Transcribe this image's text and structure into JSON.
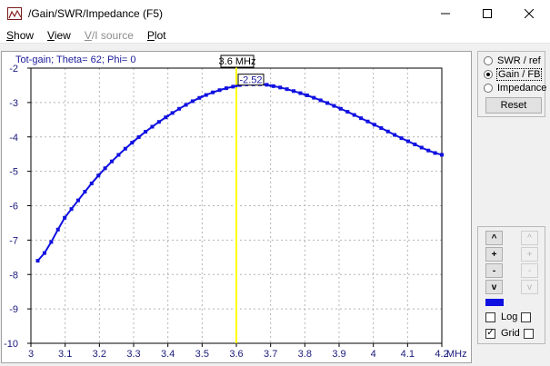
{
  "window": {
    "title": "/Gain/SWR/Impedance (F5)",
    "controls": {
      "minimize": "—",
      "maximize": "☐",
      "close": "✕"
    }
  },
  "menu": [
    {
      "label": "Show",
      "underline": "S",
      "rest": "how",
      "disabled": false
    },
    {
      "label": "View",
      "underline": "V",
      "rest": "iew",
      "disabled": false
    },
    {
      "label": "V/I source",
      "underline": "V",
      "rest": "/I source",
      "disabled": true
    },
    {
      "label": "Plot",
      "underline": "P",
      "rest": "lot",
      "disabled": false
    }
  ],
  "plot": {
    "header": "Tot-gain; Theta= 62; Phi= 0",
    "cursor": {
      "freq_label": "3.6 MHz",
      "value_label": "-2.52",
      "x": 3.6
    },
    "colors": {
      "curve": "#1010e0",
      "cursor": "#ffff00",
      "grid": "#b4b4b4"
    }
  },
  "chart_data": {
    "type": "line",
    "title": "Tot-gain; Theta= 62; Phi= 0",
    "xlabel": "MHz",
    "ylabel": "",
    "xlim": [
      3,
      4.2
    ],
    "ylim": [
      -10,
      -2
    ],
    "grid": true,
    "x_ticks": [
      "3",
      "3.1",
      "3.2",
      "3.3",
      "3.4",
      "3.5",
      "3.6",
      "3.7",
      "3.8",
      "3.9",
      "4",
      "4.1",
      "4.2"
    ],
    "y_ticks": [
      "-2",
      "-3",
      "-4",
      "-5",
      "-6",
      "-7",
      "-8",
      "-9",
      "-10"
    ],
    "series": [
      {
        "name": "Tot-gain",
        "x": [
          3.02,
          3.1,
          3.2,
          3.3,
          3.4,
          3.5,
          3.6,
          3.65,
          3.7,
          3.8,
          3.9,
          4.0,
          4.1,
          4.2
        ],
        "values": [
          -7.6,
          -6.33,
          -5.09,
          -4.13,
          -3.39,
          -2.83,
          -2.52,
          -2.47,
          -2.51,
          -2.77,
          -3.16,
          -3.63,
          -4.12,
          -4.52
        ]
      }
    ]
  },
  "sidebar": {
    "radios": [
      {
        "label": "SWR / ref",
        "checked": false
      },
      {
        "label": "Gain / FB",
        "checked": true
      },
      {
        "label": "Impedance",
        "checked": false
      }
    ],
    "reset_label": "Reset",
    "buttons_left": [
      "^",
      "+",
      "-",
      "v"
    ],
    "buttons_right": [
      "^",
      "+",
      "-",
      "v"
    ],
    "swatch_color": "#1010e0",
    "log_label": "Log",
    "grid_label": "Grid",
    "log_checked": false,
    "grid_checked": true
  }
}
